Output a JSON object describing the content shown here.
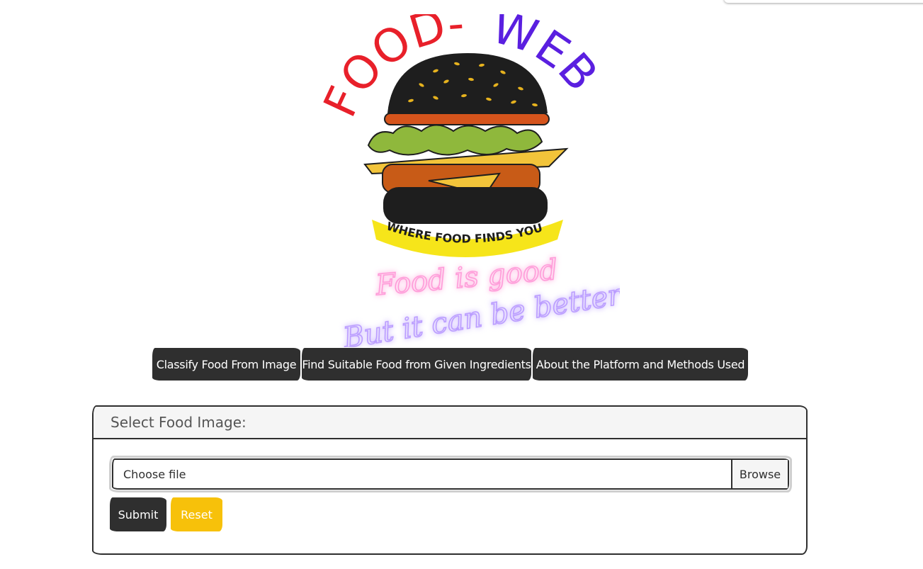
{
  "logo": {
    "title_left": "FOOD-",
    "title_right": "WEB",
    "tagline": "WHERE FOOD FINDS YOU",
    "slogan_line1": "Food is good",
    "slogan_line2": "But it can be better",
    "colors": {
      "title_left": "#e8202a",
      "title_right": "#5a1fe0",
      "bun": "#1e1e1e",
      "banner": "#f6e51a",
      "slogan_line1": "#ff9ad8",
      "slogan_line2": "#b99bff"
    }
  },
  "nav": {
    "items": [
      {
        "label": "Classify Food From Image"
      },
      {
        "label": "Find Suitable Food from Given Ingredients"
      },
      {
        "label": "About the Platform and Methods Used"
      }
    ]
  },
  "form": {
    "header": "Select Food Image:",
    "file_placeholder": "Choose file",
    "browse_label": "Browse",
    "submit_label": "Submit",
    "reset_label": "Reset"
  },
  "colors": {
    "dark": "#2f2f2f",
    "reset": "#f7c10a",
    "header_bg": "#f5f5f5"
  }
}
